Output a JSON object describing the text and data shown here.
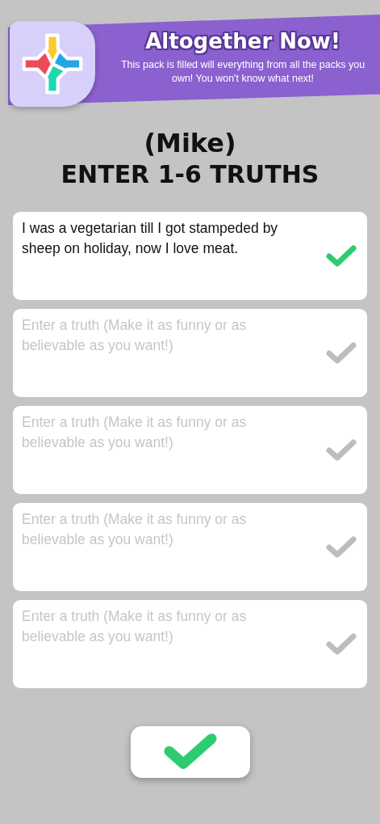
{
  "banner": {
    "title": "Altogether Now!",
    "description": "This pack is filled will everything from all the packs you own! You won't know what next!"
  },
  "player": "(Mike)",
  "heading": "ENTER 1-6 TRUTHS",
  "truths": [
    {
      "value": "I was a vegetarian till I got stampeded by sheep on holiday, now I love meat.",
      "confirmed": true
    },
    {
      "placeholder": "Enter a truth (Make it as funny or as believable as you want!)",
      "confirmed": false
    },
    {
      "placeholder": "Enter a truth (Make it as funny or as believable as you want!)",
      "confirmed": false
    },
    {
      "placeholder": "Enter a truth (Make it as funny or as believable as you want!)",
      "confirmed": false
    },
    {
      "placeholder": "Enter a truth (Make it as funny or as believable as you want!)",
      "confirmed": false
    }
  ]
}
